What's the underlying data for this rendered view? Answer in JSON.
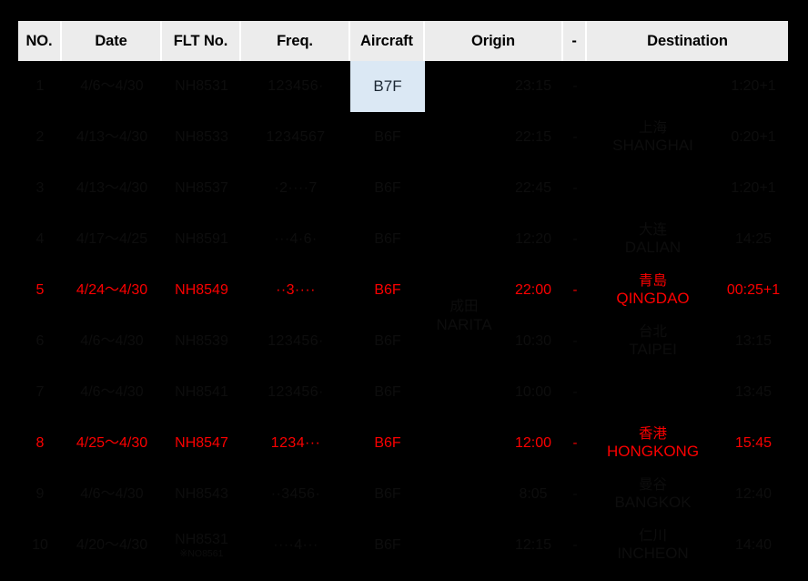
{
  "table": {
    "columns": [
      {
        "key": "no",
        "label": "NO."
      },
      {
        "key": "date",
        "label": "Date"
      },
      {
        "key": "flt",
        "label": "FLT No."
      },
      {
        "key": "freq",
        "label": "Freq."
      },
      {
        "key": "aircraft",
        "label": "Aircraft"
      },
      {
        "key": "origin",
        "label": "Origin"
      },
      {
        "key": "dash",
        "label": "-"
      },
      {
        "key": "destination",
        "label": "Destination"
      }
    ],
    "origin": {
      "cn": "成田",
      "en": "NARITA"
    },
    "colors": {
      "page_background": "#000000",
      "header_background": "#ececec",
      "header_text": "#000000",
      "dim_row_text": "#0d0d0d",
      "highlight_row_text": "#fb0000",
      "aircraft_highlight_background": "#dbe8f4",
      "aircraft_highlight_text": "#1b2733"
    },
    "rows": [
      {
        "no": "1",
        "date": "4/6～4/30",
        "flt": "NH8531",
        "flt_sub": "",
        "freq": "123456·",
        "aircraft": "B7F",
        "aircraft_highlight": true,
        "dep": "23:15",
        "dash": "-",
        "dest_cn": "",
        "dest_en": "",
        "arr": "1:20+1",
        "highlight": false
      },
      {
        "no": "2",
        "date": "4/13～4/30",
        "flt": "NH8533",
        "flt_sub": "",
        "freq": "1234567",
        "aircraft": "B6F",
        "aircraft_highlight": false,
        "dep": "22:15",
        "dash": "-",
        "dest_cn": "上海",
        "dest_en": "SHANGHAI",
        "arr": "0:20+1",
        "highlight": false
      },
      {
        "no": "3",
        "date": "4/13～4/30",
        "flt": "NH8537",
        "flt_sub": "",
        "freq": "·2····7",
        "aircraft": "B6F",
        "aircraft_highlight": false,
        "dep": "22:45",
        "dash": "-",
        "dest_cn": "",
        "dest_en": "",
        "arr": "1:20+1",
        "highlight": false
      },
      {
        "no": "4",
        "date": "4/17～4/25",
        "flt": "NH8591",
        "flt_sub": "",
        "freq": "···4·6·",
        "aircraft": "B6F",
        "aircraft_highlight": false,
        "dep": "12:20",
        "dash": "-",
        "dest_cn": "大连",
        "dest_en": "DALIAN",
        "arr": "14:25",
        "highlight": false
      },
      {
        "no": "5",
        "date": "4/24～4/30",
        "flt": "NH8549",
        "flt_sub": "",
        "freq": "··3····",
        "aircraft": "B6F",
        "aircraft_highlight": false,
        "dep": "22:00",
        "dash": "-",
        "dest_cn": "青島",
        "dest_en": "QINGDAO",
        "arr": "00:25+1",
        "highlight": true
      },
      {
        "no": "6",
        "date": "4/6～4/30",
        "flt": "NH8539",
        "flt_sub": "",
        "freq": "123456·",
        "aircraft": "B6F",
        "aircraft_highlight": false,
        "dep": "10:30",
        "dash": "-",
        "dest_cn": "台北",
        "dest_en": "TAIPEI",
        "arr": "13:15",
        "highlight": false
      },
      {
        "no": "7",
        "date": "4/6～4/30",
        "flt": "NH8541",
        "flt_sub": "",
        "freq": "123456·",
        "aircraft": "B6F",
        "aircraft_highlight": false,
        "dep": "10:00",
        "dash": "-",
        "dest_cn": "",
        "dest_en": "",
        "arr": "13:45",
        "highlight": false
      },
      {
        "no": "8",
        "date": "4/25～4/30",
        "flt": "NH8547",
        "flt_sub": "",
        "freq": "1234···",
        "aircraft": "B6F",
        "aircraft_highlight": false,
        "dep": "12:00",
        "dash": "-",
        "dest_cn": "香港",
        "dest_en": "HONGKONG",
        "arr": "15:45",
        "highlight": true
      },
      {
        "no": "9",
        "date": "4/6～4/30",
        "flt": "NH8543",
        "flt_sub": "",
        "freq": "··3456·",
        "aircraft": "B6F",
        "aircraft_highlight": false,
        "dep": "8:05",
        "dash": "-",
        "dest_cn": "曼谷",
        "dest_en": "BANGKOK",
        "arr": "12:40",
        "highlight": false
      },
      {
        "no": "10",
        "date": "4/20～4/30",
        "flt": "NH8531",
        "flt_sub": "※NO8561",
        "freq": "····4···",
        "aircraft": "B6F",
        "aircraft_highlight": false,
        "dep": "12:15",
        "dash": "-",
        "dest_cn": "仁川",
        "dest_en": "INCHEON",
        "arr": "14:40",
        "highlight": false
      }
    ]
  }
}
